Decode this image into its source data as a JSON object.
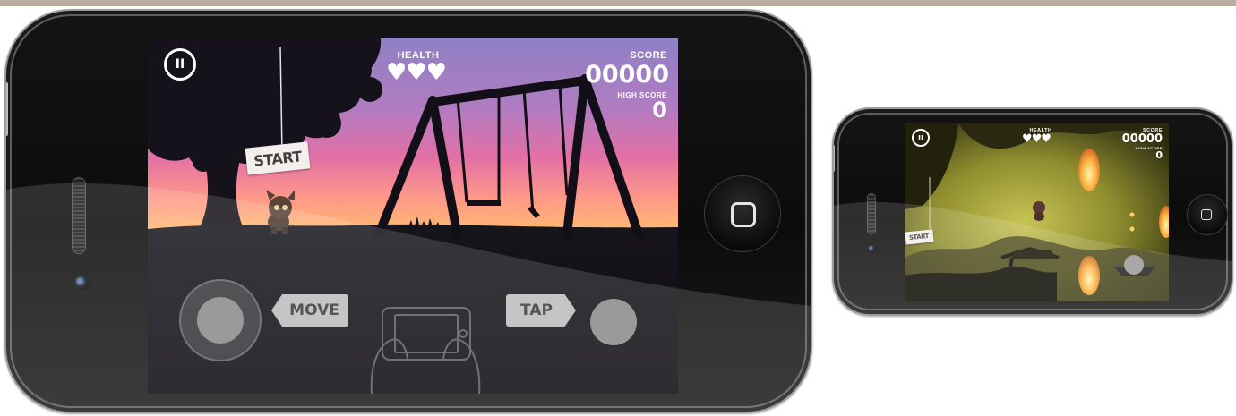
{
  "colors": {
    "sky_top": "#8e7fc2",
    "sky_mid": "#d96fa9",
    "sky_horizon": "#ffb070",
    "silhouette": "#121018",
    "cave_glow": "#a8a83a",
    "control_gray": "#bcbcbc"
  },
  "large_screen": {
    "pause_icon": "pause-circle-icon",
    "pause_glyph": "II",
    "health_label": "HEALTH",
    "hearts": "♥♥♥",
    "score_label": "SCORE",
    "score": "00000",
    "high_score_label": "HIGH SCORE",
    "high_score": "0",
    "start_sign": "START",
    "controls": {
      "move_label": "MOVE",
      "tap_label": "TAP"
    }
  },
  "small_screen": {
    "pause_glyph": "II",
    "health_label": "HEALTH",
    "hearts": "♥♥♥",
    "score_label": "SCORE",
    "score": "00000",
    "high_score_label": "HIGH SCORE",
    "high_score": "0",
    "start_sign": "START"
  }
}
